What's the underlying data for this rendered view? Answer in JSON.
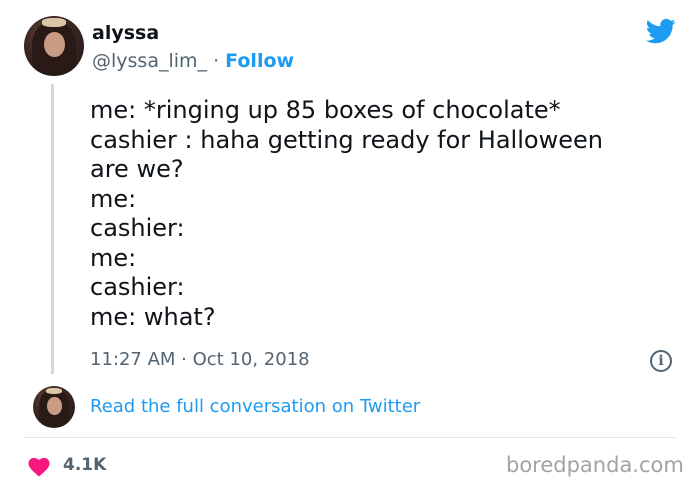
{
  "tweet": {
    "author": {
      "display_name": "alyssa",
      "handle": "@lyssa_lim_",
      "separator": "·",
      "follow_label": "Follow"
    },
    "brand_icon": "twitter-bird-icon",
    "lines": [
      "me: *ringing up 85 boxes of chocolate*",
      "cashier : haha getting ready for Halloween",
      "are we?",
      "me:",
      "cashier:",
      "me:",
      "cashier:",
      "me: what?"
    ],
    "timestamp": "11:27 AM · Oct 10, 2018",
    "info_icon": "info-icon",
    "read_conversation_label": "Read the full conversation on Twitter",
    "likes_icon": "heart-icon",
    "likes_count": "4.1K"
  },
  "watermark": "boredpanda.com",
  "colors": {
    "accent": "#1d9bf0",
    "muted": "#536471",
    "heart": "#f91880",
    "text": "#0f1419"
  }
}
